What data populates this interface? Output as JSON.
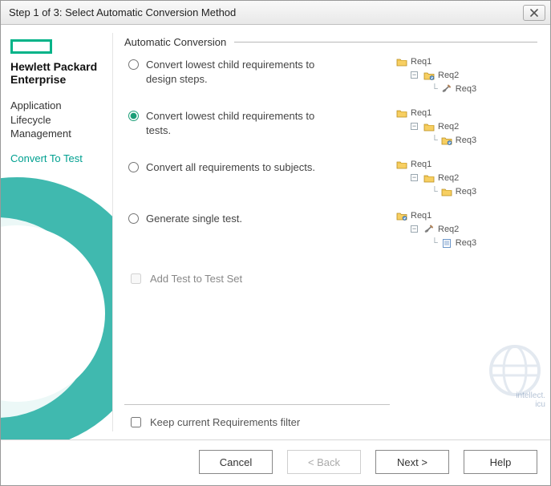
{
  "title": "Step 1 of 3: Select Automatic Conversion Method",
  "brand_line1": "Hewlett Packard",
  "brand_line2": "Enterprise",
  "sidebar": {
    "product_line1": "Application",
    "product_line2": "Lifecycle",
    "product_line3": "Management",
    "step_name": "Convert To Test"
  },
  "section_title": "Automatic Conversion",
  "options": [
    {
      "id": "opt-design-steps",
      "label": "Convert lowest child requirements to design steps.",
      "selected": false
    },
    {
      "id": "opt-tests",
      "label": "Convert lowest child requirements to tests.",
      "selected": true
    },
    {
      "id": "opt-subjects",
      "label": "Convert all requirements to subjects.",
      "selected": false
    },
    {
      "id": "opt-single-test",
      "label": "Generate single test.",
      "selected": false
    }
  ],
  "trees": [
    {
      "n1": {
        "icon": "folder",
        "label": "Req1"
      },
      "n2": {
        "icon": "testfolder",
        "label": "Req2"
      },
      "n3": {
        "icon": "step",
        "label": "Req3"
      }
    },
    {
      "n1": {
        "icon": "folder",
        "label": "Req1"
      },
      "n2": {
        "icon": "folder",
        "label": "Req2"
      },
      "n3": {
        "icon": "testfolder",
        "label": "Req3"
      }
    },
    {
      "n1": {
        "icon": "folder",
        "label": "Req1"
      },
      "n2": {
        "icon": "folder",
        "label": "Req2"
      },
      "n3": {
        "icon": "folder",
        "label": "Req3"
      }
    },
    {
      "n1": {
        "icon": "testfolder",
        "label": "Req1"
      },
      "n2": {
        "icon": "step",
        "label": "Req2"
      },
      "n3": {
        "icon": "doc",
        "label": "Req3"
      }
    }
  ],
  "checkboxes": {
    "add_to_test_set": {
      "label": "Add Test to Test Set",
      "checked": false,
      "enabled": false
    },
    "keep_filter": {
      "label": "Keep current Requirements filter",
      "checked": false,
      "enabled": true
    }
  },
  "buttons": {
    "cancel": "Cancel",
    "back": "< Back",
    "next": "Next >",
    "help": "Help"
  },
  "watermark": {
    "line1": "intellect.",
    "line2": "icu"
  }
}
